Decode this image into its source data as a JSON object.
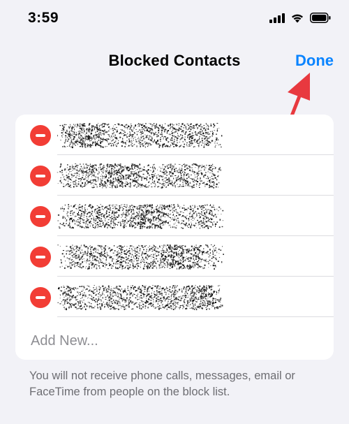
{
  "status_bar": {
    "time": "3:59",
    "icons": [
      "cellular-signal-icon",
      "wifi-icon",
      "battery-icon"
    ]
  },
  "nav": {
    "title": "Blocked Contacts",
    "done_label": "Done"
  },
  "blocked_list": {
    "items": [
      {
        "name": "redacted"
      },
      {
        "name": "redacted"
      },
      {
        "name": "redacted"
      },
      {
        "name": "redacted"
      },
      {
        "name": "redacted"
      }
    ],
    "add_new_label": "Add New..."
  },
  "footer_note": "You will not receive phone calls, messages, email or FaceTime from people on the block list.",
  "colors": {
    "accent": "#0a84ff",
    "delete": "#f23d35",
    "annotation_arrow": "#e8393f",
    "background": "#f2f2f7"
  }
}
